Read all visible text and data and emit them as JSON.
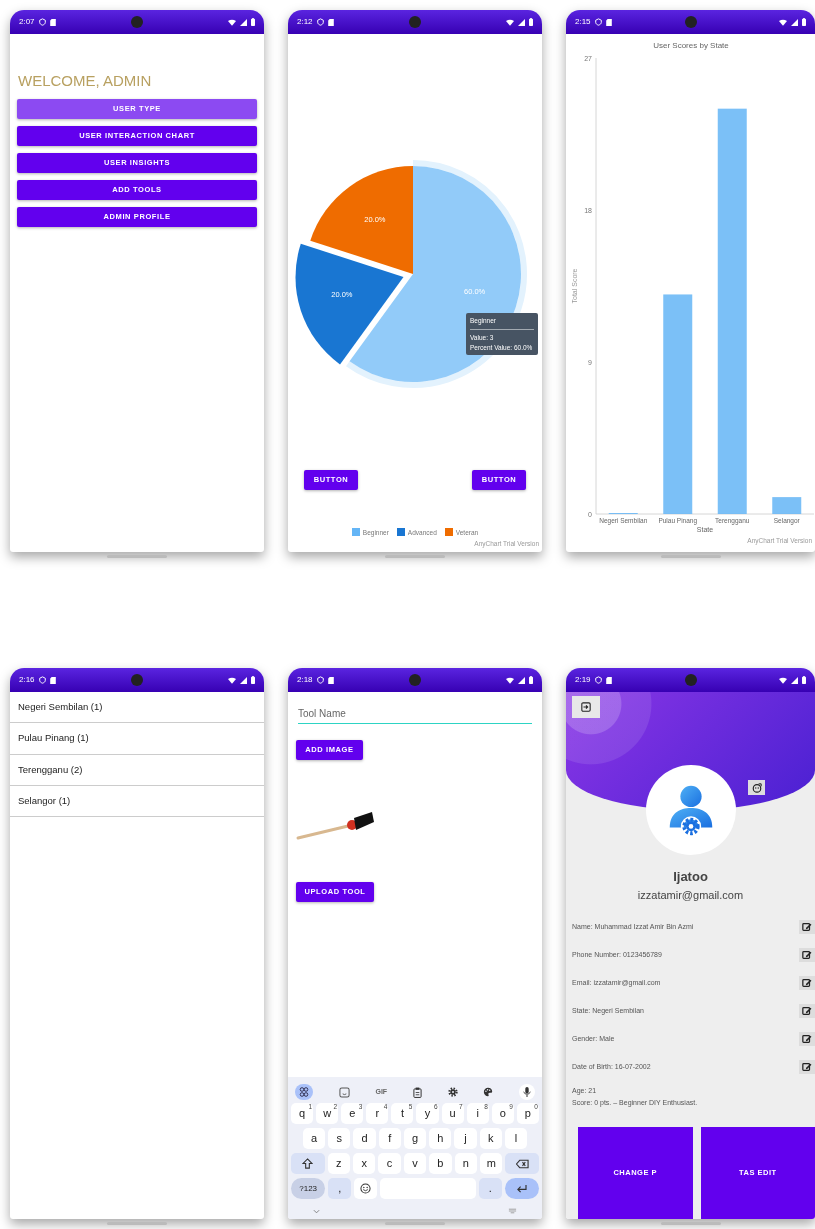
{
  "phones": [
    {
      "kind": "menu",
      "time": "2:07",
      "heading": "WELCOME, ADMIN",
      "buttons": [
        {
          "label": "USER TYPE",
          "selected": true
        },
        {
          "label": "USER INTERACTION CHART",
          "selected": false
        },
        {
          "label": "USER INSIGHTS",
          "selected": false
        },
        {
          "label": "ADD TOOLS",
          "selected": false
        },
        {
          "label": "ADMIN PROFILE",
          "selected": false
        }
      ]
    },
    {
      "kind": "pie",
      "time": "2:12",
      "chart_data": {
        "type": "pie",
        "categories": [
          "Beginner",
          "Advanced",
          "Veteran"
        ],
        "values": [
          60,
          20,
          20
        ],
        "value_labels": [
          "60.0%",
          "20.0%",
          "20.0%"
        ]
      },
      "slices": [
        {
          "hovered": true,
          "exploded": false
        },
        {
          "hovered": false,
          "exploded": true
        },
        {
          "hovered": false,
          "exploded": false
        }
      ],
      "tooltip": {
        "title": "Beginner",
        "lines": [
          "Value: 3",
          "Percent Value: 60.0%"
        ]
      },
      "buttons": [
        "BUTTON",
        "BUTTON"
      ],
      "legend": [
        {
          "color": "#64b5f6"
        },
        {
          "color": "#1976d2"
        },
        {
          "color": "#ef6c00"
        }
      ],
      "credit": "AnyChart Trial Version"
    },
    {
      "kind": "bar",
      "time": "2:15",
      "chart_data": {
        "type": "bar",
        "title": "User Scores by State",
        "xlabel": "State",
        "ylabel": "Total Score",
        "categories": [
          "Negeri Sembilan",
          "Pulau Pinang",
          "Terengganu",
          "Selangor"
        ],
        "values": [
          0,
          13,
          24,
          1
        ],
        "ylim": [
          0,
          27
        ],
        "yticks": [
          0,
          9,
          18,
          27
        ]
      },
      "credit": "AnyChart Trial Version"
    },
    {
      "kind": "list",
      "time": "2:16",
      "items": [
        "Negeri Sembilan (1)",
        "Pulau Pinang (1)",
        "Terengganu (2)",
        "Selangor (1)"
      ]
    },
    {
      "kind": "form",
      "time": "2:18",
      "tool_name": {
        "placeholder": "Tool Name"
      },
      "add_image": "ADD IMAGE",
      "upload": "UPLOAD TOOL",
      "keyboard": {
        "toolbar": [
          {
            "kind": "apps"
          },
          {
            "kind": "sticker"
          },
          {
            "kind": "text",
            "label": "GIF"
          },
          {
            "kind": "clipboard"
          },
          {
            "kind": "settings"
          },
          {
            "kind": "palette"
          },
          {
            "kind": "mic"
          }
        ],
        "rows": [
          {
            "keys": [
              {
                "kind": "char",
                "label": "q",
                "hint": "1"
              },
              {
                "kind": "char",
                "label": "w",
                "hint": "2"
              },
              {
                "kind": "char",
                "label": "e",
                "hint": "3"
              },
              {
                "kind": "char",
                "label": "r",
                "hint": "4"
              },
              {
                "kind": "char",
                "label": "t",
                "hint": "5"
              },
              {
                "kind": "char",
                "label": "y",
                "hint": "6"
              },
              {
                "kind": "char",
                "label": "u",
                "hint": "7"
              },
              {
                "kind": "char",
                "label": "i",
                "hint": "8"
              },
              {
                "kind": "char",
                "label": "o",
                "hint": "9"
              },
              {
                "kind": "char",
                "label": "p",
                "hint": "0"
              }
            ]
          },
          {
            "keys": [
              {
                "kind": "char",
                "label": "a"
              },
              {
                "kind": "char",
                "label": "s"
              },
              {
                "kind": "char",
                "label": "d"
              },
              {
                "kind": "char",
                "label": "f"
              },
              {
                "kind": "char",
                "label": "g"
              },
              {
                "kind": "char",
                "label": "h"
              },
              {
                "kind": "char",
                "label": "j"
              },
              {
                "kind": "char",
                "label": "k"
              },
              {
                "kind": "char",
                "label": "l"
              }
            ]
          },
          {
            "keys": [
              {
                "kind": "shift"
              },
              {
                "kind": "char",
                "label": "z"
              },
              {
                "kind": "char",
                "label": "x"
              },
              {
                "kind": "char",
                "label": "c"
              },
              {
                "kind": "char",
                "label": "v"
              },
              {
                "kind": "char",
                "label": "b"
              },
              {
                "kind": "char",
                "label": "n"
              },
              {
                "kind": "char",
                "label": "m"
              },
              {
                "kind": "backspace"
              }
            ]
          },
          {
            "keys": [
              {
                "kind": "symbols",
                "label": "?123"
              },
              {
                "kind": "mod",
                "label": ","
              },
              {
                "kind": "emoji"
              },
              {
                "kind": "space"
              },
              {
                "kind": "mod",
                "label": "."
              },
              {
                "kind": "enter"
              }
            ]
          }
        ]
      }
    },
    {
      "kind": "profile",
      "time": "2:19",
      "username": "Ijatoo",
      "email": "izzatamir@gmail.com",
      "fields": [
        "Name: Muhammad Izzat Amir Bin Azmi",
        "Phone Number: 0123456789",
        "Email: izzatamir@gmail.com",
        "State: Negeri Sembilan",
        "Gender: Male",
        "Date of Birth: 16-07-2002"
      ],
      "notes": [
        "Age: 21",
        "Score: 0 pts. – Beginner DIY Enthusiast."
      ],
      "buttons": [
        "CHANGE P",
        "TAS EDIT"
      ]
    }
  ]
}
